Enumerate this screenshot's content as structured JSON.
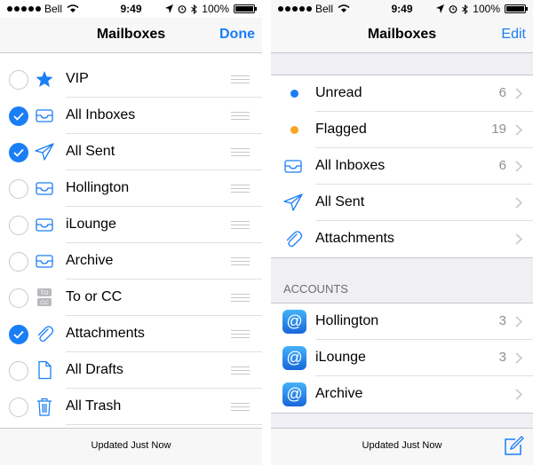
{
  "status": {
    "carrier": "Bell",
    "time": "9:49",
    "battery": "100%"
  },
  "left": {
    "nav": {
      "title": "Mailboxes",
      "action": "Done"
    },
    "rows": [
      {
        "label": "VIP",
        "checked": false,
        "icon": "star-icon"
      },
      {
        "label": "All Inboxes",
        "checked": true,
        "icon": "inbox-tray-icon"
      },
      {
        "label": "All Sent",
        "checked": true,
        "icon": "paper-plane-icon"
      },
      {
        "label": "Hollington",
        "checked": false,
        "icon": "inbox-tray-icon"
      },
      {
        "label": "iLounge",
        "checked": false,
        "icon": "inbox-tray-icon"
      },
      {
        "label": "Archive",
        "checked": false,
        "icon": "inbox-tray-icon"
      },
      {
        "label": "To or CC",
        "checked": false,
        "icon": "to-cc-icon"
      },
      {
        "label": "Attachments",
        "checked": true,
        "icon": "paperclip-icon"
      },
      {
        "label": "All Drafts",
        "checked": false,
        "icon": "document-icon"
      },
      {
        "label": "All Trash",
        "checked": false,
        "icon": "trash-icon"
      }
    ],
    "footer": "Updated Just Now"
  },
  "right": {
    "nav": {
      "title": "Mailboxes",
      "action": "Edit"
    },
    "mailboxes": [
      {
        "label": "Unread",
        "count": "6",
        "icon": "blue-dot"
      },
      {
        "label": "Flagged",
        "count": "19",
        "icon": "orange-dot"
      },
      {
        "label": "All Inboxes",
        "count": "6",
        "icon": "inbox-tray-icon"
      },
      {
        "label": "All Sent",
        "count": "",
        "icon": "paper-plane-icon"
      },
      {
        "label": "Attachments",
        "count": "",
        "icon": "paperclip-icon"
      }
    ],
    "accounts_header": "ACCOUNTS",
    "accounts": [
      {
        "label": "Hollington",
        "count": "3"
      },
      {
        "label": "iLounge",
        "count": "3"
      },
      {
        "label": "Archive",
        "count": ""
      }
    ],
    "footer": "Updated Just Now"
  },
  "colors": {
    "accent": "#1a7ef5",
    "unread": "#1a7ef5",
    "flagged": "#f5a623"
  }
}
